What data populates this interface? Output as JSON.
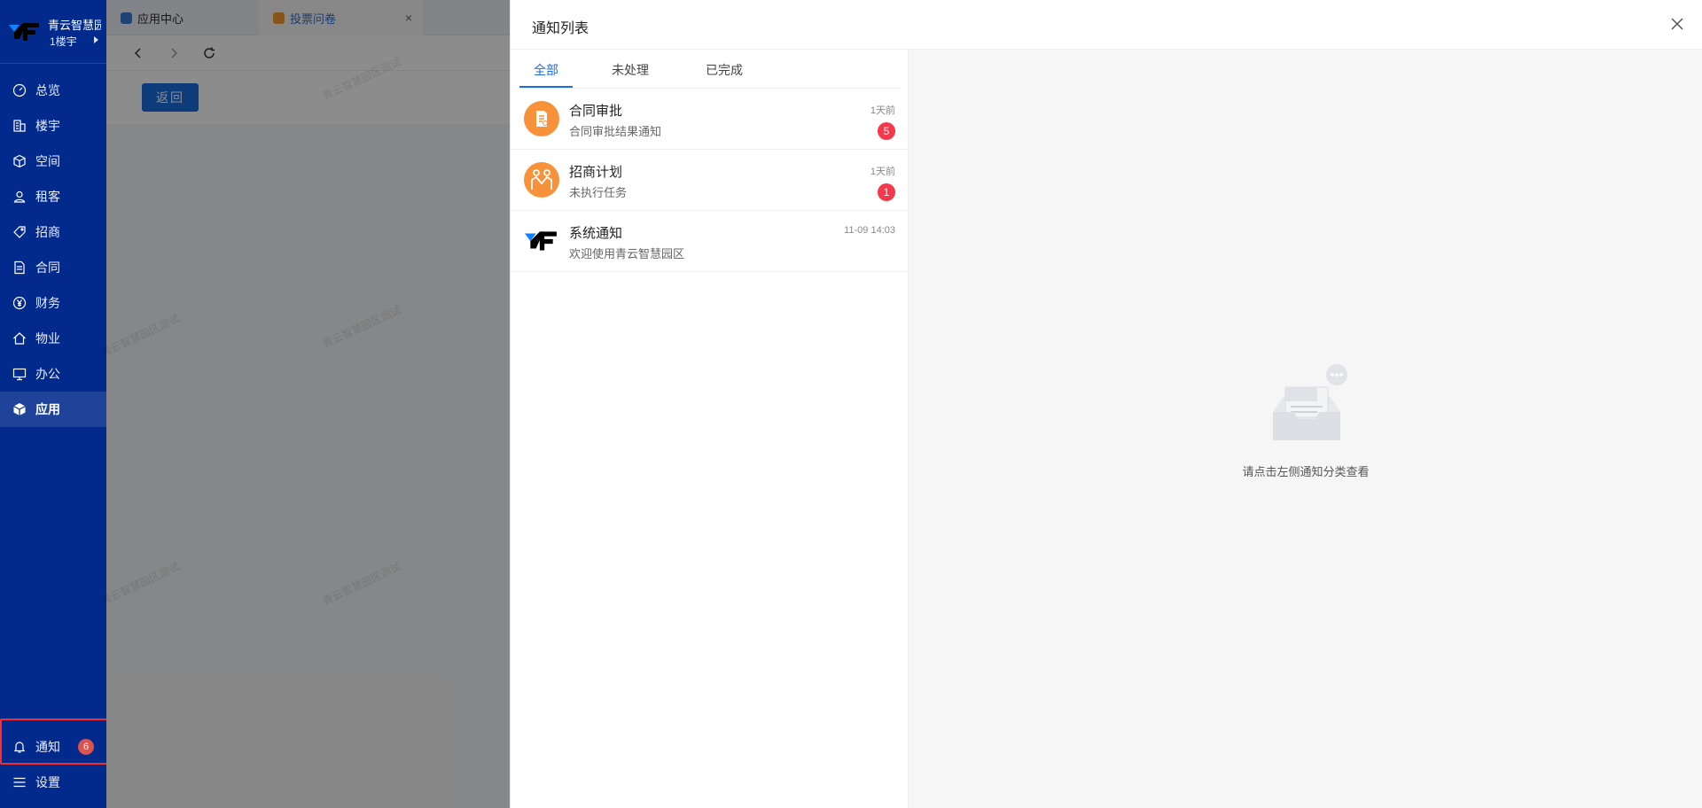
{
  "brand": {
    "name": "青云智慧园区",
    "building": "1楼宇"
  },
  "nav": {
    "items": [
      {
        "label": "总览",
        "icon": "dashboard-icon"
      },
      {
        "label": "楼宇",
        "icon": "building-icon"
      },
      {
        "label": "空间",
        "icon": "cube-icon"
      },
      {
        "label": "租客",
        "icon": "user-icon"
      },
      {
        "label": "招商",
        "icon": "tag-icon"
      },
      {
        "label": "合同",
        "icon": "document-icon"
      },
      {
        "label": "财务",
        "icon": "yen-icon"
      },
      {
        "label": "物业",
        "icon": "home-icon"
      },
      {
        "label": "办公",
        "icon": "monitor-icon"
      },
      {
        "label": "应用",
        "icon": "box-icon",
        "active": true
      }
    ],
    "notice_label": "通知",
    "notice_count": "6",
    "settings_label": "设置"
  },
  "tabs": [
    {
      "label": "应用中心"
    },
    {
      "label": "投票问卷",
      "active": true
    }
  ],
  "content": {
    "back_label": "返回",
    "watermark": "青云智慧园区测试"
  },
  "drawer": {
    "title": "通知列表",
    "filters": [
      "全部",
      "未处理",
      "已完成"
    ],
    "notices": [
      {
        "title": "合同审批",
        "desc": "合同审批结果通知",
        "time": "1天前",
        "badge": "5"
      },
      {
        "title": "招商计划",
        "desc": "未执行任务",
        "time": "1天前",
        "badge": "1"
      },
      {
        "title": "系统通知",
        "desc": "欢迎使用青云智慧园区",
        "time": "11-09 14:03",
        "badge": ""
      }
    ],
    "empty_text": "请点击左侧通知分类查看"
  },
  "colors": {
    "sidebar": "#022a8c",
    "accent": "#1b6ee0",
    "badge": "#f5384c",
    "avatar_orange": "#f7923a"
  }
}
